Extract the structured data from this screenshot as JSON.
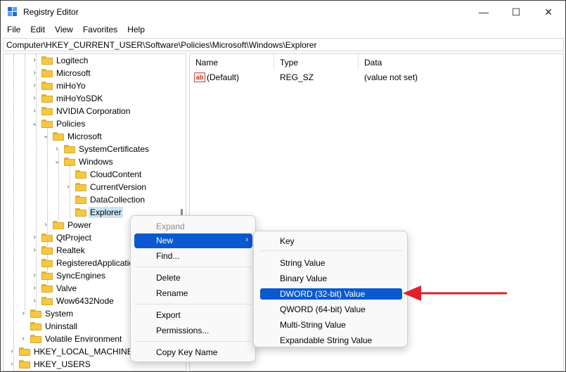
{
  "window": {
    "title": "Registry Editor",
    "controls": {
      "minimize": "—",
      "maximize": "☐",
      "close": "✕"
    }
  },
  "menubar": [
    "File",
    "Edit",
    "View",
    "Favorites",
    "Help"
  ],
  "address": "Computer\\HKEY_CURRENT_USER\\Software\\Policies\\Microsoft\\Windows\\Explorer",
  "tree": [
    {
      "label": "Logitech",
      "chevron": ">"
    },
    {
      "label": "Microsoft",
      "chevron": ">"
    },
    {
      "label": "miHoYo",
      "chevron": ">"
    },
    {
      "label": "miHoYoSDK",
      "chevron": ">"
    },
    {
      "label": "NVIDIA Corporation",
      "chevron": ">"
    },
    {
      "label": "Policies",
      "chevron": "v"
    },
    {
      "label": "Microsoft",
      "chevron": "v"
    },
    {
      "label": "SystemCertificates",
      "chevron": ">"
    },
    {
      "label": "Windows",
      "chevron": "v"
    },
    {
      "label": "CloudContent",
      "chevron": ""
    },
    {
      "label": "CurrentVersion",
      "chevron": ">"
    },
    {
      "label": "DataCollection",
      "chevron": ""
    },
    {
      "label": "Explorer",
      "chevron": "",
      "selected": true
    },
    {
      "label": "Power",
      "chevron": ">"
    },
    {
      "label": "QtProject",
      "chevron": ">"
    },
    {
      "label": "Realtek",
      "chevron": ">"
    },
    {
      "label": "RegisteredApplications",
      "chevron": ""
    },
    {
      "label": "SyncEngines",
      "chevron": ">"
    },
    {
      "label": "Valve",
      "chevron": ">"
    },
    {
      "label": "Wow6432Node",
      "chevron": ">"
    },
    {
      "label": "System",
      "chevron": ">"
    },
    {
      "label": "Uninstall",
      "chevron": ""
    },
    {
      "label": "Volatile Environment",
      "chevron": ">"
    },
    {
      "label": "HKEY_LOCAL_MACHINE",
      "chevron": ">"
    },
    {
      "label": "HKEY_USERS",
      "chevron": ">"
    }
  ],
  "values": {
    "headers": {
      "name": "Name",
      "type": "Type",
      "data": "Data"
    },
    "rows": [
      {
        "icon": "ab",
        "name": "(Default)",
        "type": "REG_SZ",
        "data": "(value not set)"
      }
    ]
  },
  "context_menu": {
    "expand": "Expand",
    "new": "New",
    "new_arrow": "›",
    "find": "Find...",
    "delete": "Delete",
    "rename": "Rename",
    "export": "Export",
    "permissions": "Permissions...",
    "copy_key_name": "Copy Key Name"
  },
  "submenu": {
    "key": "Key",
    "string_value": "String Value",
    "binary_value": "Binary Value",
    "dword_value": "DWORD (32-bit) Value",
    "qword_value": "QWORD (64-bit) Value",
    "multi_string_value": "Multi-String Value",
    "expandable_string_value": "Expandable String Value"
  },
  "colors": {
    "accent": "#0a59d0",
    "selection": "#cce4f7",
    "folder": "#f5c842",
    "annotation_arrow": "#e0202a"
  }
}
